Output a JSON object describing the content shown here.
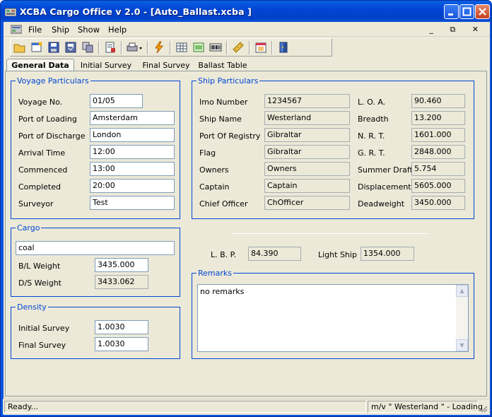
{
  "window": {
    "title": "XCBA Cargo Office v 2.0 - [Auto_Ballast.xcba ]",
    "minimize_glyph": "_",
    "maximize_glyph": "□",
    "close_glyph": "✕"
  },
  "menu": {
    "items": [
      "File",
      "Ship",
      "Show",
      "Help"
    ],
    "mdi_controls": "_ ⧉ ✕"
  },
  "toolbar": {
    "icons": [
      "open-folder-icon",
      "new-window-icon",
      "save-icon",
      "save-all-icon",
      "copy-icon",
      "paste-report-icon",
      "print-icon",
      "flash-icon",
      "grid-table-icon",
      "spreadsheet-icon",
      "barcode-icon",
      "ruler-icon",
      "calendar-icon",
      "exit-icon"
    ]
  },
  "tabs": [
    "General Data",
    "Initial Survey",
    "Final Survey",
    "Ballast Table"
  ],
  "voyage": {
    "legend": "Voyage Particulars",
    "fields": [
      {
        "label": "Voyage No.",
        "value": "01/05"
      },
      {
        "label": "Port of Loading",
        "value": "Amsterdam"
      },
      {
        "label": "Port of Discharge",
        "value": "London"
      },
      {
        "label": "Arrival Time",
        "value": "12:00"
      },
      {
        "label": "Commenced",
        "value": "13:00"
      },
      {
        "label": "Completed",
        "value": "20:00"
      },
      {
        "label": "Surveyor",
        "value": "Test"
      }
    ]
  },
  "ship": {
    "legend": "Ship Particulars",
    "left": [
      {
        "label": "Imo Number",
        "value": "1234567"
      },
      {
        "label": "Ship Name",
        "value": "Westerland"
      },
      {
        "label": "Port Of Registry",
        "value": "Gibraltar"
      },
      {
        "label": "Flag",
        "value": "Gibraltar"
      },
      {
        "label": "Owners",
        "value": "Owners"
      },
      {
        "label": "Captain",
        "value": "Captain"
      },
      {
        "label": "Chief Officer",
        "value": "ChOfficer"
      }
    ],
    "right": [
      {
        "label": "L. O. A.",
        "value": "90.460"
      },
      {
        "label": "Breadth",
        "value": "13.200"
      },
      {
        "label": "N. R. T.",
        "value": "1601.000"
      },
      {
        "label": "G. R. T.",
        "value": "2848.000"
      },
      {
        "label": "Summer Draft",
        "value": "5.754"
      },
      {
        "label": "Displacement",
        "value": "5605.000"
      },
      {
        "label": "Deadweight",
        "value": "3450.000"
      }
    ]
  },
  "cargo": {
    "legend": "Cargo",
    "name": "coal",
    "bl_label": "B/L Weight",
    "bl_value": "3435.000",
    "ds_label": "D/S Weight",
    "ds_value": "3433.062"
  },
  "lbp": {
    "label": "L. B. P.",
    "value": "84.390"
  },
  "light_ship": {
    "label": "Light Ship",
    "value": "1354.000"
  },
  "remarks": {
    "legend": "Remarks",
    "text": "no remarks"
  },
  "density": {
    "legend": "Density",
    "initial_label": "Initial Survey",
    "initial_value": "1.0030",
    "final_label": "Final Survey",
    "final_value": "1.0030"
  },
  "status": {
    "left": "Ready...",
    "right": "m/v  \" Westerland \" - Loading"
  }
}
